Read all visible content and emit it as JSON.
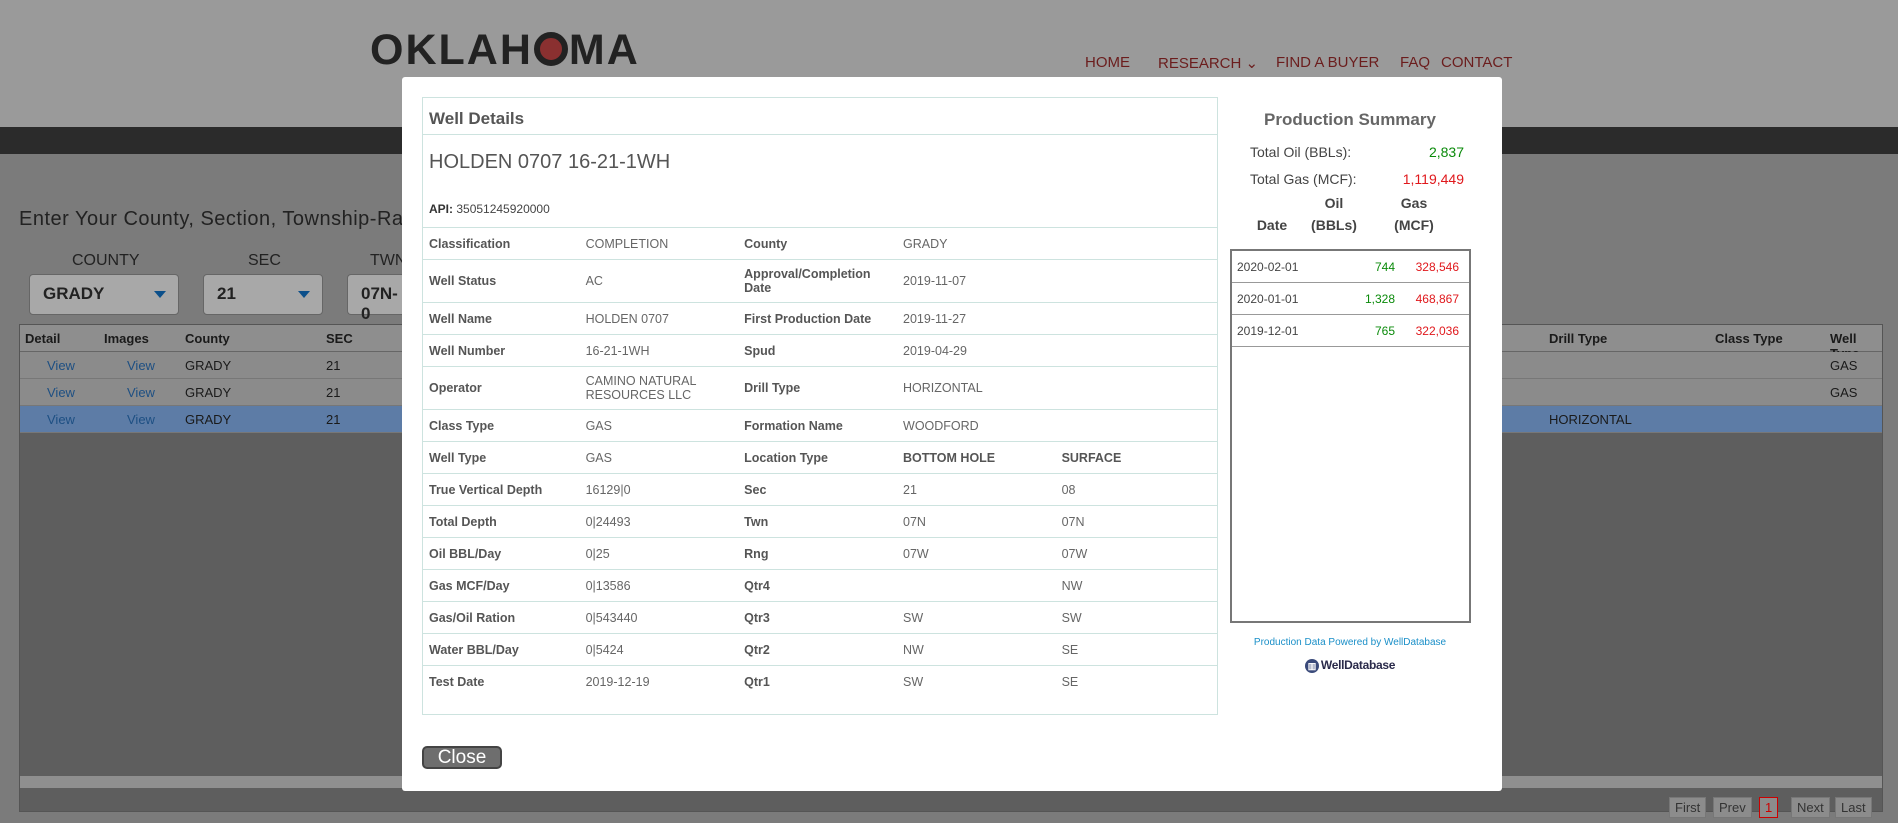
{
  "header": {
    "logo_text": "OKLAHOMA",
    "nav": [
      "HOME",
      "RESEARCH",
      "FIND A BUYER",
      "FAQ",
      "CONTACT"
    ]
  },
  "background": {
    "instructions": "Enter Your County, Section, Township-Ra",
    "filters": [
      {
        "label": "COUNTY",
        "value": "GRADY"
      },
      {
        "label": "SEC",
        "value": "21"
      },
      {
        "label": "TWN",
        "value": "07N-0"
      }
    ],
    "grid_headers": [
      "Detail",
      "Images",
      "County",
      "SEC",
      "Drill Type",
      "Class Type",
      "Well Type"
    ],
    "grid_rows": [
      {
        "detail": "View",
        "images": "View",
        "county": "GRADY",
        "sec": "21",
        "drill_type": "",
        "class_type": "",
        "well_type": "GAS"
      },
      {
        "detail": "View",
        "images": "View",
        "county": "GRADY",
        "sec": "21",
        "drill_type": "",
        "class_type": "",
        "well_type": "GAS"
      },
      {
        "detail": "View",
        "images": "View",
        "county": "GRADY",
        "sec": "21",
        "drill_type": "HORIZONTAL",
        "class_type": "",
        "well_type": ""
      }
    ],
    "pager": [
      "First",
      "Prev",
      "1",
      "Next",
      "Last"
    ]
  },
  "modal": {
    "title": "Well Details",
    "well_name": "HOLDEN 0707 16-21-1WH",
    "api_label": "API:",
    "api_value": "35051245920000",
    "rows": [
      [
        "Classification",
        "COMPLETION",
        "County",
        "GRADY",
        ""
      ],
      [
        "Well Status",
        "AC",
        "Approval/Completion Date",
        "2019-11-07",
        ""
      ],
      [
        "Well Name",
        "HOLDEN 0707",
        "First Production Date",
        "2019-11-27",
        ""
      ],
      [
        "Well Number",
        "16-21-1WH",
        "Spud",
        "2019-04-29",
        ""
      ],
      [
        "Operator",
        "CAMINO NATURAL RESOURCES LLC",
        "Drill Type",
        "HORIZONTAL",
        ""
      ],
      [
        "Class Type",
        "GAS",
        "Formation Name",
        "WOODFORD",
        ""
      ],
      [
        "Well Type",
        "GAS",
        "Location Type",
        "BOTTOM HOLE",
        "SURFACE"
      ],
      [
        "True Vertical Depth",
        "16129|0",
        "Sec",
        "21",
        "08"
      ],
      [
        "Total Depth",
        "0|24493",
        "Twn",
        "07N",
        "07N"
      ],
      [
        "Oil BBL/Day",
        "0|25",
        "Rng",
        "07W",
        "07W"
      ],
      [
        "Gas MCF/Day",
        "0|13586",
        "Qtr4",
        "",
        "NW"
      ],
      [
        "Gas/Oil Ration",
        "0|543440",
        "Qtr3",
        "SW",
        "SW"
      ],
      [
        "Water BBL/Day",
        "0|5424",
        "Qtr2",
        "NW",
        "SE"
      ],
      [
        "Test Date",
        "2019-12-19",
        "Qtr1",
        "SW",
        "SE"
      ]
    ],
    "close_label": "Close"
  },
  "production": {
    "title": "Production Summary",
    "total_oil_label": "Total Oil (BBLs):",
    "total_oil": "2,837",
    "total_gas_label": "Total Gas (MCF):",
    "total_gas": "1,119,449",
    "col_date": "Date",
    "col_oil_1": "Oil",
    "col_oil_2": "(BBLs)",
    "col_gas_1": "Gas",
    "col_gas_2": "(MCF)",
    "rows": [
      {
        "date": "2020-02-01",
        "oil": "744",
        "gas": "328,546"
      },
      {
        "date": "2020-01-01",
        "oil": "1,328",
        "gas": "468,867"
      },
      {
        "date": "2019-12-01",
        "oil": "765",
        "gas": "322,036"
      }
    ],
    "powered_by": "Production Data Powered by WellDatabase",
    "logo_text": "WellDatabase"
  },
  "colors": {
    "oil": "#0a8a0a",
    "gas": "#e0181c",
    "nav": "#6b1d1d"
  }
}
